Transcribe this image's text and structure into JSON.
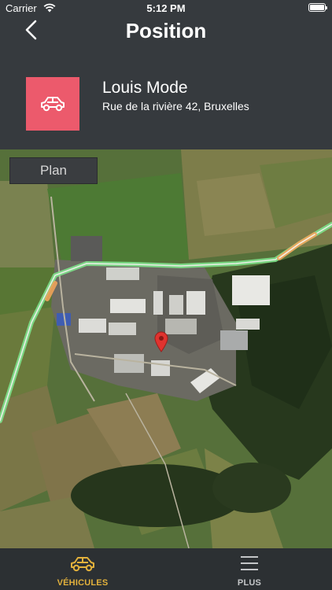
{
  "status_bar": {
    "carrier": "Carrier",
    "time": "5:12 PM",
    "icons": [
      "wifi-icon",
      "battery-icon"
    ]
  },
  "nav": {
    "title": "Position",
    "back_icon": "chevron-left-icon"
  },
  "vehicle": {
    "name": "Louis Mode",
    "address": "Rue de la rivière 42, Bruxelles",
    "icon": "car-icon",
    "tile_color": "#ec5a6c"
  },
  "map": {
    "map_type_label": "Plan",
    "marker_icon": "map-pin-icon",
    "route_color": "#7ee08a"
  },
  "tab_bar": {
    "tabs": [
      {
        "label": "VÉHICULES",
        "icon": "car-icon",
        "active": true,
        "color": "#e2b13c"
      },
      {
        "label": "PLUS",
        "icon": "menu-icon",
        "active": false,
        "color": "#c4c6c8"
      }
    ]
  }
}
